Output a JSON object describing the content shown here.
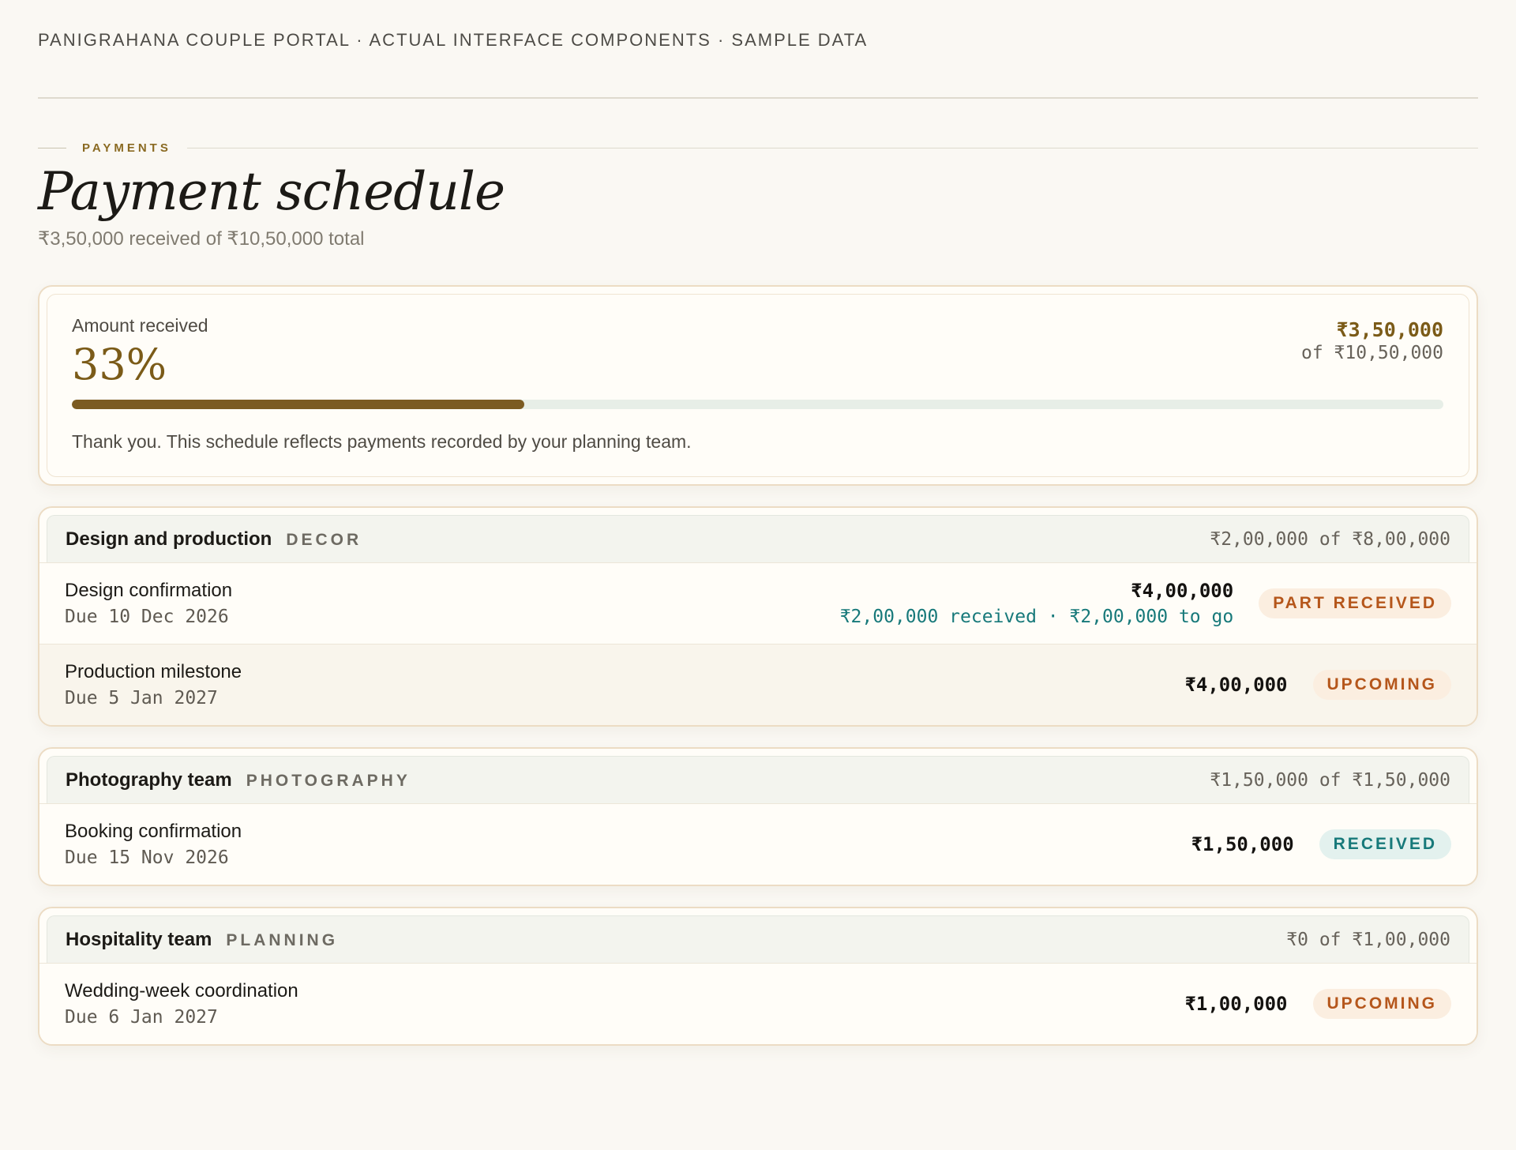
{
  "header": {
    "text": "PANIGRAHANA COUPLE PORTAL · ACTUAL INTERFACE COMPONENTS · SAMPLE DATA"
  },
  "section": {
    "eyebrow": "PAYMENTS",
    "title": "Payment schedule",
    "subtitle": "₹3,50,000 received of ₹10,50,000 total"
  },
  "summary": {
    "label": "Amount received",
    "percent_text": "33%",
    "progress_fraction": 0.33,
    "received": "₹3,50,000",
    "total": "of ₹10,50,000",
    "note": "Thank you. This schedule reflects payments recorded by your planning team."
  },
  "groups": [
    {
      "name": "Design and production",
      "category": "DECOR",
      "total": "₹2,00,000 of ₹8,00,000",
      "items": [
        {
          "title": "Design confirmation",
          "due": "Due 10 Dec 2026",
          "amount": "₹4,00,000",
          "progress": "₹2,00,000 received · ₹2,00,000 to go",
          "status": "PART RECEIVED"
        },
        {
          "title": "Production milestone",
          "due": "Due 5 Jan 2027",
          "amount": "₹4,00,000",
          "status": "UPCOMING"
        }
      ]
    },
    {
      "name": "Photography team",
      "category": "PHOTOGRAPHY",
      "total": "₹1,50,000 of ₹1,50,000",
      "items": [
        {
          "title": "Booking confirmation",
          "due": "Due 15 Nov 2026",
          "amount": "₹1,50,000",
          "status": "RECEIVED"
        }
      ]
    },
    {
      "name": "Hospitality team",
      "category": "PLANNING",
      "total": "₹0 of ₹1,00,000",
      "items": [
        {
          "title": "Wedding-week coordination",
          "due": "Due 6 Jan 2027",
          "amount": "₹1,00,000",
          "status": "UPCOMING"
        }
      ]
    }
  ],
  "colors": {
    "accent": "#7b5b18",
    "received": "#17797a",
    "pending": "#b5561b",
    "background": "#faf8f3"
  }
}
